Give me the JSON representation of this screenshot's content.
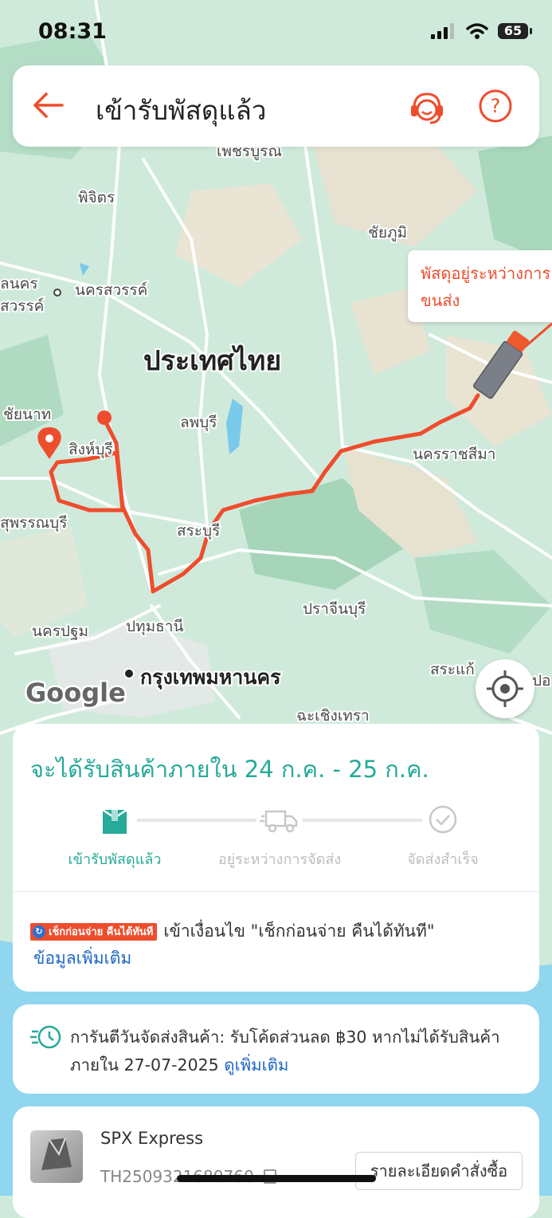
{
  "status_bar": {
    "time": "08:31",
    "battery": "65"
  },
  "header": {
    "title": "เข้ารับพัสดุแล้ว"
  },
  "map": {
    "labels": [
      {
        "text": "เพชรบูรณ์"
      },
      {
        "text": "พิจิตร"
      },
      {
        "text": "ชัยภูมิ"
      },
      {
        "text": "ลนคร"
      },
      {
        "text": "นครสวรรค์"
      },
      {
        "text": "สวรรค์"
      },
      {
        "text": "ประเทศไทย"
      },
      {
        "text": "ชัยนาท"
      },
      {
        "text": "สิงห์บุรี"
      },
      {
        "text": "ลพบุรี"
      },
      {
        "text": "นครราชสีมา"
      },
      {
        "text": "สุพรรณบุรี"
      },
      {
        "text": "สระบุรี"
      },
      {
        "text": "ปราจีนบุรี"
      },
      {
        "text": "นครปฐม"
      },
      {
        "text": "ปทุมธานี"
      },
      {
        "text": "กรุงเทพมหานคร"
      },
      {
        "text": "สระแก้"
      },
      {
        "text": "ฉะเชิงเทรา"
      },
      {
        "text": "ปอ"
      },
      {
        "text": "Google"
      }
    ],
    "bubble": "พัสดุอยู่ระหว่างการ\nขนส่ง",
    "route_color": "#ee4d2d"
  },
  "delivery": {
    "eta": "จะได้รับสินค้าภายใน 24 ก.ค. - 25 ก.ค.",
    "steps": [
      {
        "label": "เข้ารับพัสดุแล้ว",
        "active": true,
        "icon": "package-icon"
      },
      {
        "label": "อยู่ระหว่างการจัดส่ง",
        "active": false,
        "icon": "truck-icon"
      },
      {
        "label": "จัดส่งสำเร็จ",
        "active": false,
        "icon": "check-circle-icon"
      }
    ],
    "cod_badge": "เช็กก่อนจ่าย คืนได้ทันที",
    "cod_text": "เข้าเงื่อนไข \"เช็กก่อนจ่าย คืนได้ทันที\"",
    "more_info": "ข้อมูลเพิ่มเติม"
  },
  "guarantee": {
    "text": "การันตีวันจัดส่งสินค้า: รับโค้ดส่วนลด ฿30 หากไม่ได้รับสินค้าภายใน 27-07-2025",
    "link": "ดูเพิ่มเติม"
  },
  "shipment": {
    "carrier": "SPX Express",
    "tracking": "TH2509321680760",
    "order_details_button": "รายละเอียดคำสั่งซื้อ"
  },
  "colors": {
    "accent": "#ee4d2d",
    "teal": "#26aa99",
    "link": "#1e66c4"
  }
}
